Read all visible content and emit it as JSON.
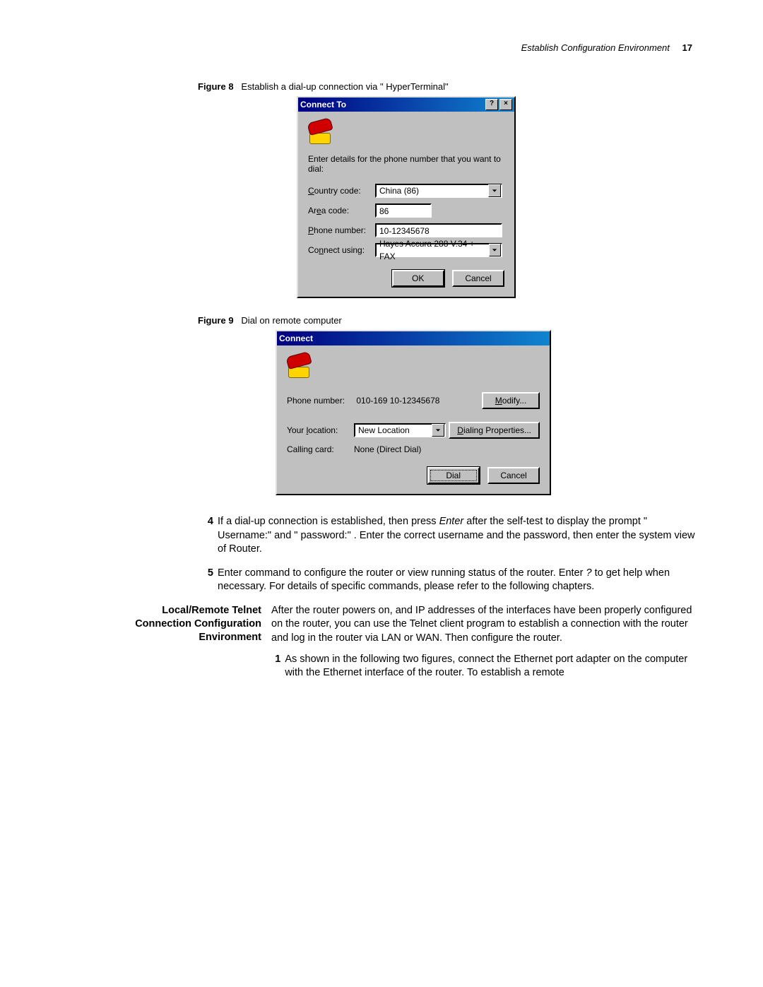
{
  "header": {
    "title": "Establish Configuration Environment",
    "page": "17"
  },
  "fig8": {
    "label": "Figure 8",
    "caption": "Establish a dial-up connection via \" HyperTerminal\"",
    "window_title": "Connect To",
    "instruction": "Enter details for the phone number that you want to dial:",
    "labels": {
      "country": "ountry code:",
      "country_u": "C",
      "area": "Ar",
      "area_u": "e",
      "area2": "a code:",
      "phone": "hone number:",
      "phone_u": "P",
      "connect": "Co",
      "connect_u": "n",
      "connect2": "nect using:"
    },
    "values": {
      "country": "China (86)",
      "area": "86",
      "phone": "10-12345678",
      "connect": "Hayes Accura 288 V.34 + FAX"
    },
    "buttons": {
      "ok": "OK",
      "cancel": "Cancel"
    }
  },
  "fig9": {
    "label": "Figure 9",
    "caption": "Dial on remote computer",
    "window_title": "Connect",
    "labels": {
      "phone": "Phone number:",
      "location_pre": "Your ",
      "location_u": "l",
      "location_post": "ocation:",
      "card": "Calling card:",
      "modify_u": "M",
      "modify": "odify...",
      "dialprop_u": "D",
      "dialprop": "ialing Properties..."
    },
    "values": {
      "phone": "010-169 10-12345678",
      "location": "New Location",
      "card": "None (Direct Dial)"
    },
    "buttons": {
      "dial": "Dial",
      "cancel": "Cancel"
    }
  },
  "steps": {
    "s4_num": "4",
    "s4": "If a dial-up connection is established, then press Enter after the self-test to display the prompt \" Username:\" and \" password:\" . Enter the correct username and the password, then enter the system view of Router.",
    "s5_num": "5",
    "s5": "Enter command to configure the router or view running status of the router. Enter ? to get help when necessary. For details of specific commands, please refer to the following chapters."
  },
  "section": {
    "heading": "Local/Remote Telnet Connection Configuration Environment",
    "para": "After the router powers on, and IP addresses of the interfaces have been properly configured on the router, you can use the Telnet client program to establish a connection with the router and log in the router via LAN or WAN. Then configure the router.",
    "s1_num": "1",
    "s1": "As shown in the following two figures, connect the Ethernet port adapter on the computer with the Ethernet interface of the router. To establish a remote"
  }
}
